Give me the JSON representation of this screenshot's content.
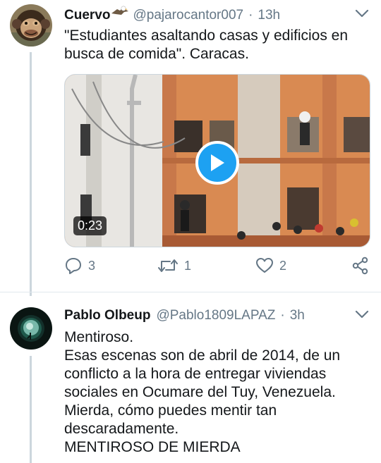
{
  "tweet1": {
    "author_name": "Cuervo",
    "handle": "@pajarocantor007",
    "separator": "·",
    "time": "13h",
    "text_lines": [
      "\"Estudiantes asaltando casas y edificios en",
      "busca de comida\". Caracas."
    ],
    "video_duration": "0:23",
    "replies": "3",
    "retweets": "1",
    "likes": "2"
  },
  "tweet2": {
    "author_name": "Pablo Olbeup",
    "handle": "@Pablo1809LAPAZ",
    "separator": "·",
    "time": "3h",
    "text_lines": [
      "Mentiroso.",
      "Esas escenas son de abril de 2014, de un",
      "conflicto a la hora de entregar viviendas",
      "sociales en Ocumare del Tuy, Venezuela.",
      "Mierda, cómo puedes mentir tan",
      "descaradamente.",
      "MENTIROSO DE MIERDA"
    ]
  },
  "colors": {
    "accent": "#1da1f2",
    "secondary_text": "#657786",
    "thread_line": "#ccd6dd"
  },
  "icons": [
    "chimp-avatar",
    "eagle-emoji-icon",
    "chevron-down-icon",
    "play-icon",
    "reply-icon",
    "retweet-icon",
    "like-icon",
    "share-icon",
    "moon-avatar"
  ]
}
